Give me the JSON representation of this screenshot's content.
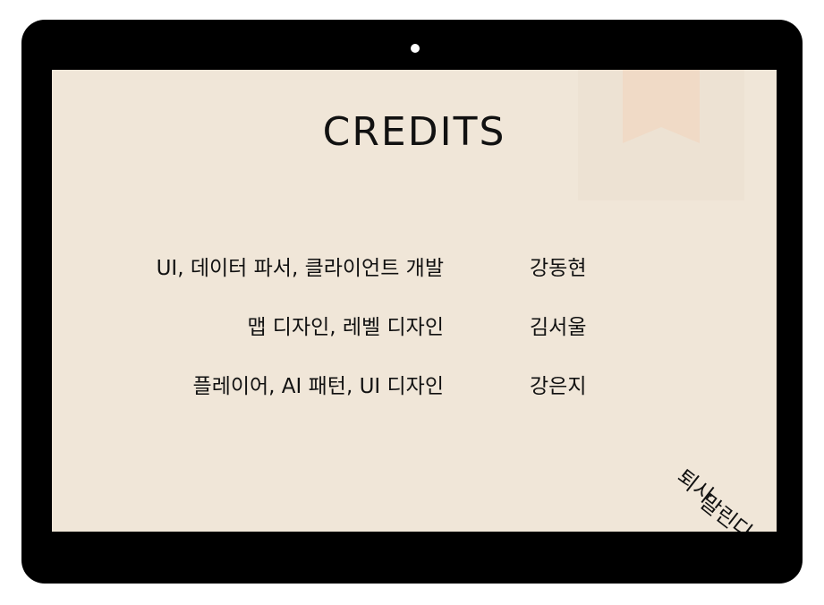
{
  "screen": {
    "title": "CREDITS"
  },
  "credits": [
    {
      "role": "UI, 데이터 파서, 클라이언트 개발",
      "name": "강동현"
    },
    {
      "role": "맵 디자인, 레벨 디자인",
      "name": "김서울"
    },
    {
      "role": "플레이어, AI 패턴, UI 디자인",
      "name": "강은지"
    }
  ],
  "logo": {
    "line1": "퇴사",
    "line2": "말린다"
  },
  "colors": {
    "bezel": "#000000",
    "screen_bg": "#f0e6d8",
    "bookmark": "#f0dac6",
    "text": "#111111"
  }
}
